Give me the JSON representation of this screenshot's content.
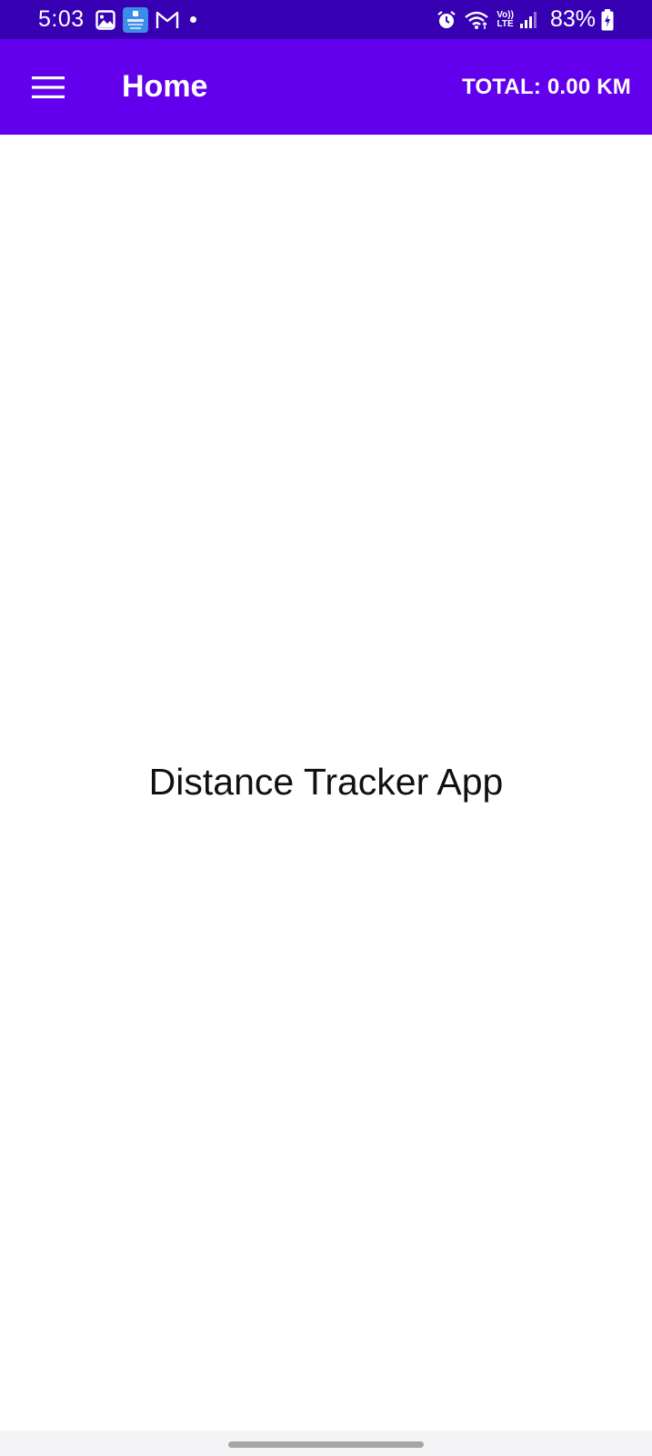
{
  "status_bar": {
    "time": "5:03",
    "battery": "83%",
    "network_label_top": "Vo))",
    "network_label_bottom": "LTE",
    "gmail_letter": "M"
  },
  "app_bar": {
    "title": "Home",
    "total": "TOTAL: 0.00 KM",
    "color": "#6200EE",
    "status_color": "#3700B3"
  },
  "main": {
    "heading": "Distance Tracker App"
  },
  "icons": {
    "menu": "hamburger-menu-icon",
    "gallery": "image-icon",
    "app_notification": "app-notification-icon",
    "gmail": "gmail-icon",
    "alarm": "alarm-icon",
    "wifi": "wifi-icon",
    "signal": "signal-icon",
    "battery": "battery-charging-icon"
  }
}
